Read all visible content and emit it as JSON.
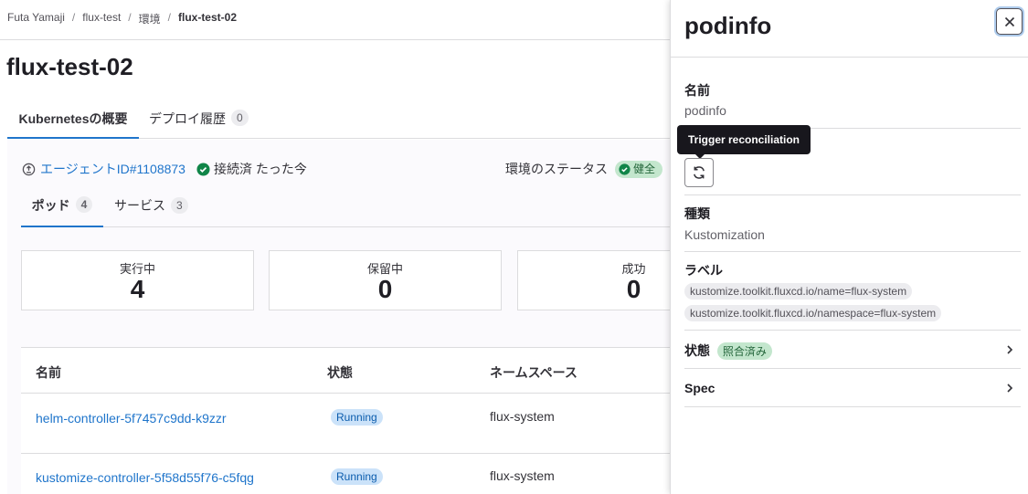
{
  "breadcrumb": [
    "Futa Yamaji",
    "flux-test",
    "環境",
    "flux-test-02"
  ],
  "page_title": "flux-test-02",
  "main_tabs": [
    {
      "label": "Kubernetesの概要"
    },
    {
      "label": "デプロイ履歴",
      "count": "0"
    }
  ],
  "agent": {
    "link": "エージェントID#1108873",
    "connected": "接続済 たった今"
  },
  "env_status": {
    "label": "環境のステータス",
    "badge": "健全"
  },
  "sub_tabs": [
    {
      "label": "ポッド",
      "count": "4"
    },
    {
      "label": "サービス",
      "count": "3"
    }
  ],
  "stats": [
    {
      "label": "実行中",
      "value": "4"
    },
    {
      "label": "保留中",
      "value": "0"
    },
    {
      "label": "成功",
      "value": "0"
    }
  ],
  "table": {
    "headers": [
      "名前",
      "状態",
      "ネームスペース"
    ],
    "rows": [
      {
        "name": "helm-controller-5f7457c9dd-k9zzr",
        "status": "Running",
        "namespace": "flux-system"
      },
      {
        "name": "kustomize-controller-5f58d55f76-c5fqg",
        "status": "Running",
        "namespace": "flux-system"
      }
    ]
  },
  "drawer": {
    "title": "podinfo",
    "name_label": "名前",
    "name_value": "podinfo",
    "tooltip": "Trigger reconciliation",
    "kind_label": "種類",
    "kind_value": "Kustomization",
    "labels_label": "ラベル",
    "labels": [
      "kustomize.toolkit.fluxcd.io/name=flux-system",
      "kustomize.toolkit.fluxcd.io/namespace=flux-system"
    ],
    "status_label": "状態",
    "status_badge": "照合済み",
    "spec_label": "Spec"
  },
  "colors": {
    "link": "#1f75cb",
    "success": "#108548",
    "running_bg": "#cbe2f9",
    "tooltip_bg": "#18171d"
  }
}
